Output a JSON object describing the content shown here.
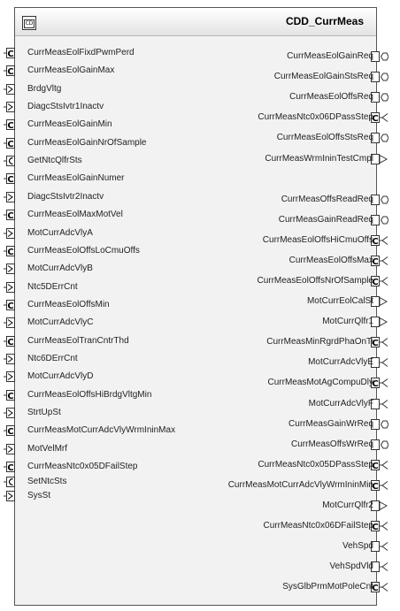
{
  "component": {
    "name": "CDD_CurrMeas",
    "icon_text": "CD",
    "icon": "composition-icon"
  },
  "left_ports": [
    {
      "label": "CurrMeasEolFixdPwmPerd",
      "kind": "client"
    },
    {
      "label": "CurrMeasEolGainMax",
      "kind": "client"
    },
    {
      "label": "BrdgVltg",
      "kind": "receiver"
    },
    {
      "label": "DiagcStsIvtr1Inactv",
      "kind": "receiver"
    },
    {
      "label": "CurrMeasEolGainMin",
      "kind": "client"
    },
    {
      "label": "CurrMeasEolGainNrOfSample",
      "kind": "client"
    },
    {
      "label": "GetNtcQlfrSts",
      "kind": "client-open"
    },
    {
      "label": "CurrMeasEolGainNumer",
      "kind": "client"
    },
    {
      "label": "DiagcStsIvtr2Inactv",
      "kind": "receiver"
    },
    {
      "label": "CurrMeasEolMaxMotVel",
      "kind": "client"
    },
    {
      "label": "MotCurrAdcVlyA",
      "kind": "receiver"
    },
    {
      "label": "CurrMeasEolOffsLoCmuOffs",
      "kind": "client"
    },
    {
      "label": "MotCurrAdcVlyB",
      "kind": "receiver"
    },
    {
      "label": "Ntc5DErrCnt",
      "kind": "receiver"
    },
    {
      "label": "CurrMeasEolOffsMin",
      "kind": "client"
    },
    {
      "label": "MotCurrAdcVlyC",
      "kind": "receiver"
    },
    {
      "label": "CurrMeasEolTranCntrThd",
      "kind": "client"
    },
    {
      "label": "Ntc6DErrCnt",
      "kind": "receiver"
    },
    {
      "label": "MotCurrAdcVlyD",
      "kind": "receiver"
    },
    {
      "label": "CurrMeasEolOffsHiBrdgVltgMin",
      "kind": "client"
    },
    {
      "label": "StrtUpSt",
      "kind": "receiver"
    },
    {
      "label": "CurrMeasMotCurrAdcVlyWrmIninMax",
      "kind": "client"
    },
    {
      "label": "MotVelMrf",
      "kind": "receiver"
    },
    {
      "label": "CurrMeasNtc0x05DFailStep",
      "kind": "client"
    },
    {
      "label": "SetNtcSts",
      "kind": "client-open"
    },
    {
      "label": "SysSt",
      "kind": "receiver"
    }
  ],
  "right_ports": [
    {
      "label": "CurrMeasEolGainReq",
      "kind": "nvdata"
    },
    {
      "label": "CurrMeasEolGainStsReq",
      "kind": "nvdata"
    },
    {
      "label": "CurrMeasEolOffsReq",
      "kind": "nvdata"
    },
    {
      "label": "CurrMeasNtc0x06DPassStep",
      "kind": "client"
    },
    {
      "label": "CurrMeasEolOffsStsReq",
      "kind": "nvdata"
    },
    {
      "label": "CurrMeasWrmIninTestCmpl",
      "kind": "sender"
    },
    {
      "label": "CurrMeasOffsReadReq",
      "kind": "nvdata"
    },
    {
      "label": "CurrMeasGainReadReq",
      "kind": "nvdata"
    },
    {
      "label": "CurrMeasEolOffsHiCmuOffs",
      "kind": "client"
    },
    {
      "label": "CurrMeasEolOffsMax",
      "kind": "client"
    },
    {
      "label": "CurrMeasEolOffsNrOfSample",
      "kind": "client"
    },
    {
      "label": "MotCurrEolCalSt",
      "kind": "sender"
    },
    {
      "label": "MotCurrQlfr1",
      "kind": "sender"
    },
    {
      "label": "CurrMeasMinRgrdPhaOnTi",
      "kind": "client"
    },
    {
      "label": "MotCurrAdcVlyE",
      "kind": "receiver"
    },
    {
      "label": "CurrMeasMotAgCompuDly",
      "kind": "client"
    },
    {
      "label": "MotCurrAdcVlyF",
      "kind": "receiver"
    },
    {
      "label": "CurrMeasGainWrReq",
      "kind": "nvdata"
    },
    {
      "label": "CurrMeasOffsWrReq",
      "kind": "nvdata"
    },
    {
      "label": "CurrMeasNtc0x05DPassStep",
      "kind": "client"
    },
    {
      "label": "CurrMeasMotCurrAdcVlyWrmIninMin",
      "kind": "client"
    },
    {
      "label": "MotCurrQlfr2",
      "kind": "sender"
    },
    {
      "label": "CurrMeasNtc0x06DFailStep",
      "kind": "client"
    },
    {
      "label": "VehSpd",
      "kind": "receiver"
    },
    {
      "label": "VehSpdVld",
      "kind": "receiver"
    },
    {
      "label": "SysGlbPrmMotPoleCnt",
      "kind": "client"
    }
  ]
}
